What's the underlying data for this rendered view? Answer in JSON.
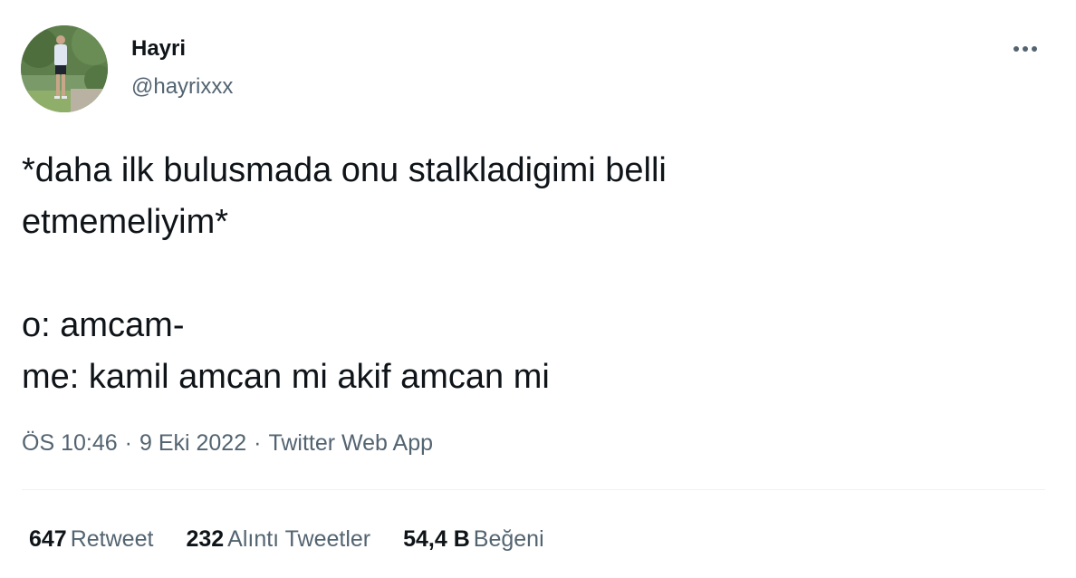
{
  "author": {
    "display_name": "Hayri",
    "handle": "@hayrixxx"
  },
  "icons": {
    "more": "more-horizontal-icon"
  },
  "tweet": {
    "text": "*daha ilk bulusmada onu stalkladigimi belli\netmemeliyim*\n\no: amcam-\nme: kamil amcan mi akif amcan mi",
    "time": "ÖS 10:46",
    "date": "9 Eki 2022",
    "source": "Twitter Web App",
    "separator": "·"
  },
  "stats": {
    "retweets": {
      "count": "647",
      "label": "Retweet"
    },
    "quotes": {
      "count": "232",
      "label": "Alıntı Tweetler"
    },
    "likes": {
      "count": "54,4 B",
      "label": "Beğeni"
    }
  },
  "colors": {
    "text_primary": "#0f1419",
    "text_secondary": "#536471",
    "divider": "#eff3f4"
  }
}
